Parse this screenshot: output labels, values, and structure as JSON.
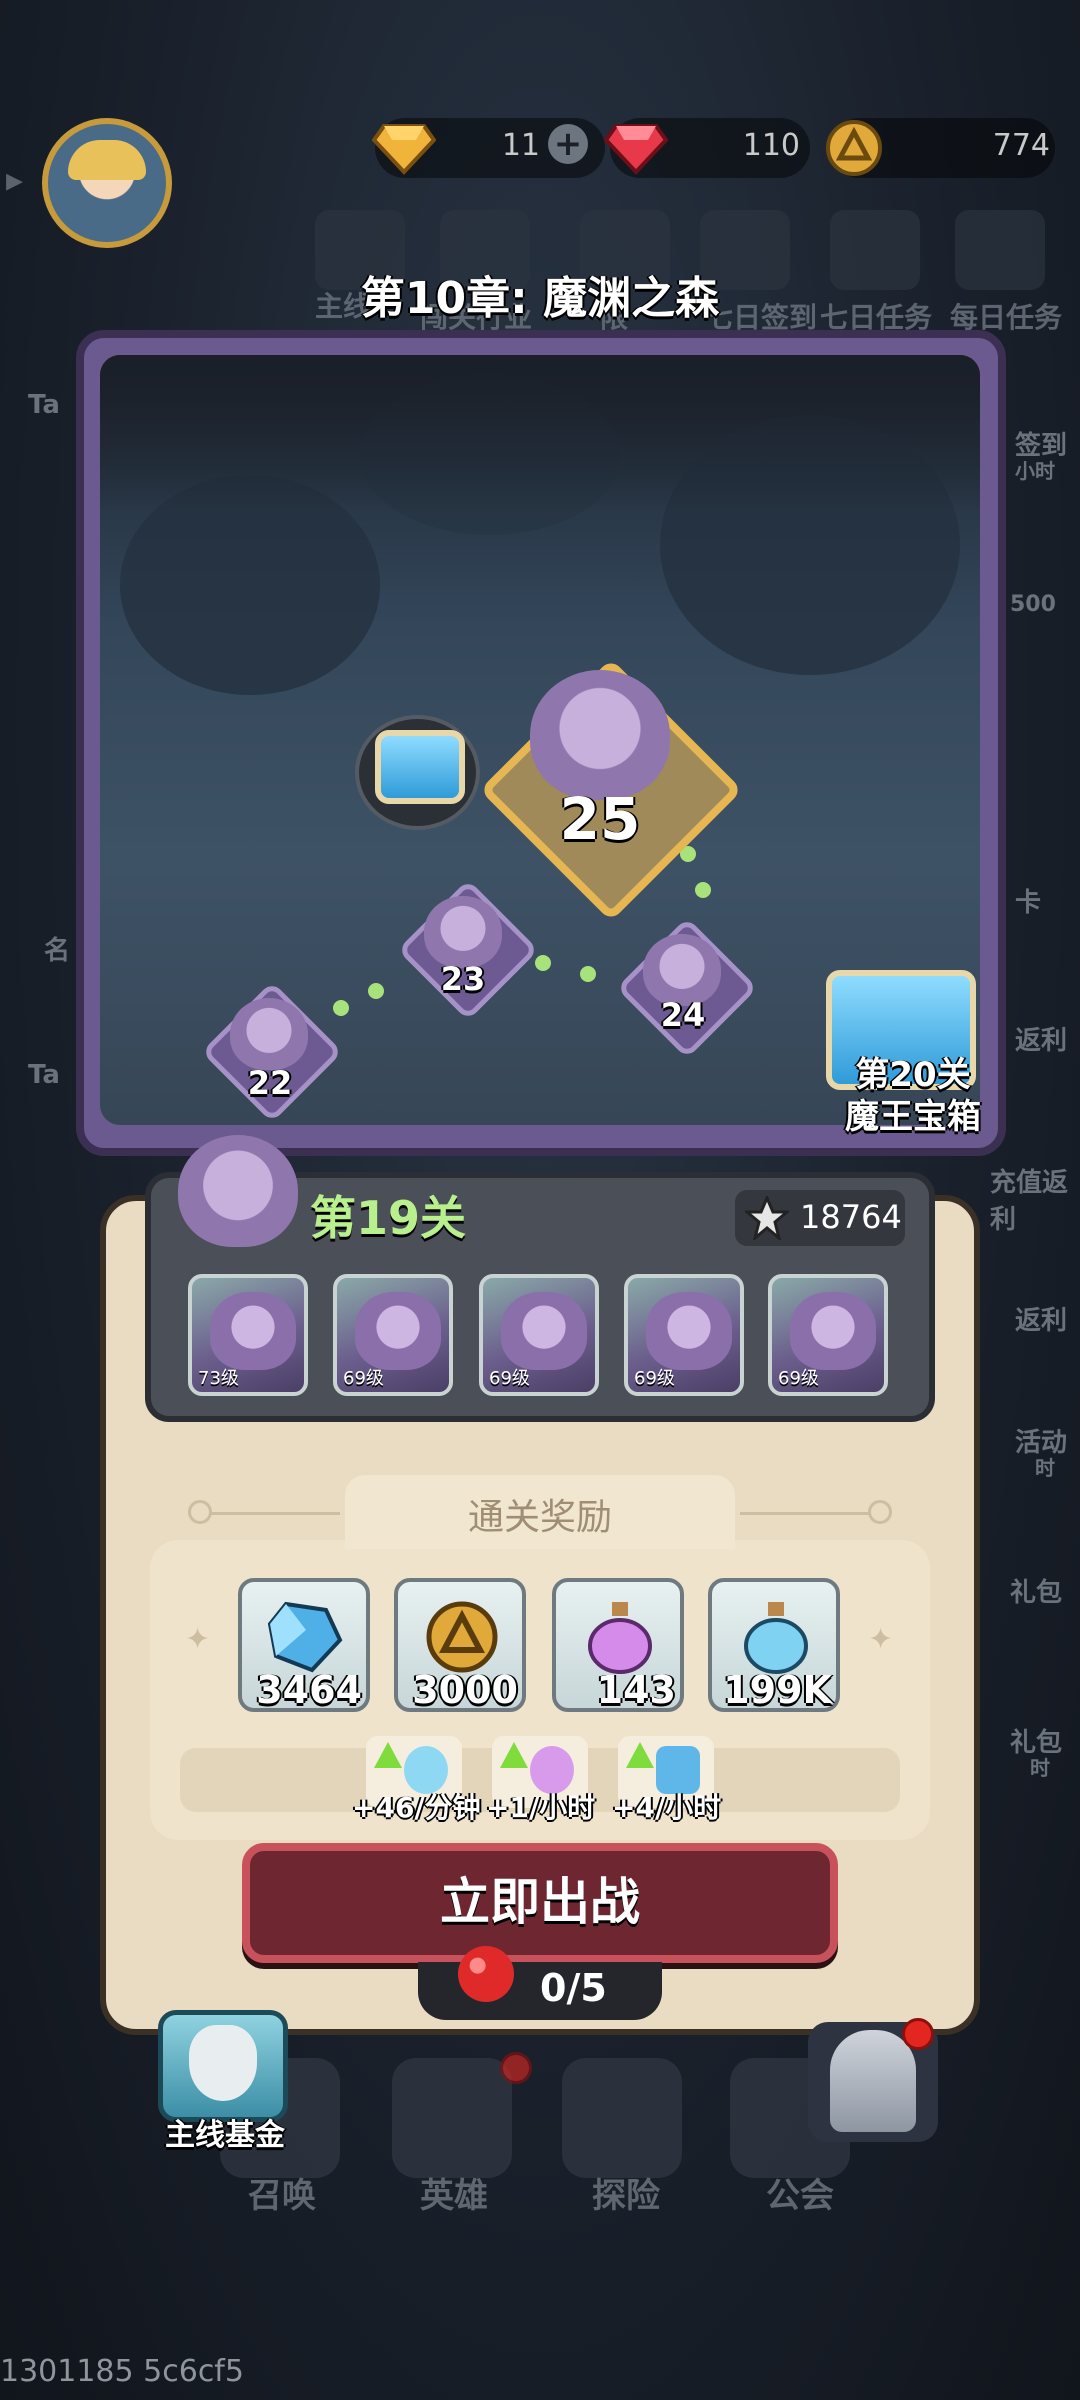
{
  "currencies": [
    {
      "icon": "gold-gem-icon",
      "value": "11"
    },
    {
      "icon": "red-gem-icon",
      "value": "110"
    },
    {
      "icon": "gold-coin-icon",
      "value": "774"
    }
  ],
  "background_menu": {
    "top_icons": [
      "主线",
      "闯关行业",
      "限",
      "七日签到",
      "七日任务",
      "每日任务"
    ],
    "right_labels": [
      "签到",
      "小时",
      "500",
      "卡",
      "返利",
      "充值返利",
      "返利",
      "活动",
      "时",
      "礼包",
      "礼包",
      "时"
    ],
    "left_labels": [
      "Ta",
      "名",
      "Ta"
    ]
  },
  "chapter_title": "第10章: 魔渊之森",
  "map": {
    "nodes": [
      {
        "label": "22"
      },
      {
        "label": "23"
      },
      {
        "label": "24"
      },
      {
        "label": "25"
      }
    ],
    "boss_chest_label_line1": "第20关",
    "boss_chest_label_line2": "魔王宝箱"
  },
  "stage": {
    "name": "第19关",
    "power": "18764",
    "enemies": [
      {
        "level": "73级"
      },
      {
        "level": "69级"
      },
      {
        "level": "69级"
      },
      {
        "level": "69级"
      },
      {
        "level": "69级"
      }
    ]
  },
  "rewards": {
    "title": "通关奖励",
    "items": [
      {
        "icon": "blue-crystal-icon",
        "amount": "3464"
      },
      {
        "icon": "gold-coin-icon",
        "amount": "3000"
      },
      {
        "icon": "purple-potion-icon",
        "amount": "143"
      },
      {
        "icon": "blue-potion-icon",
        "amount": "199K"
      }
    ],
    "idle": [
      {
        "icon": "exp-potion-up-icon",
        "rate": "+46/分钟"
      },
      {
        "icon": "purple-potion-up-icon",
        "rate": "+1/小时"
      },
      {
        "icon": "crystal-up-icon",
        "rate": "+4/小时"
      }
    ]
  },
  "fight_button": "立即出战",
  "stamina": "0/5",
  "fund_label": "主线基金",
  "bottom_nav": [
    "召唤",
    "英雄",
    "探险",
    "公会"
  ],
  "footer_text": "1301185 5c6cf5",
  "colors": {
    "panel": "#e9dcc2",
    "stage_name": "#b8f08d",
    "fight_button": "#6e2730",
    "map_frame": "#6b5a8f"
  }
}
